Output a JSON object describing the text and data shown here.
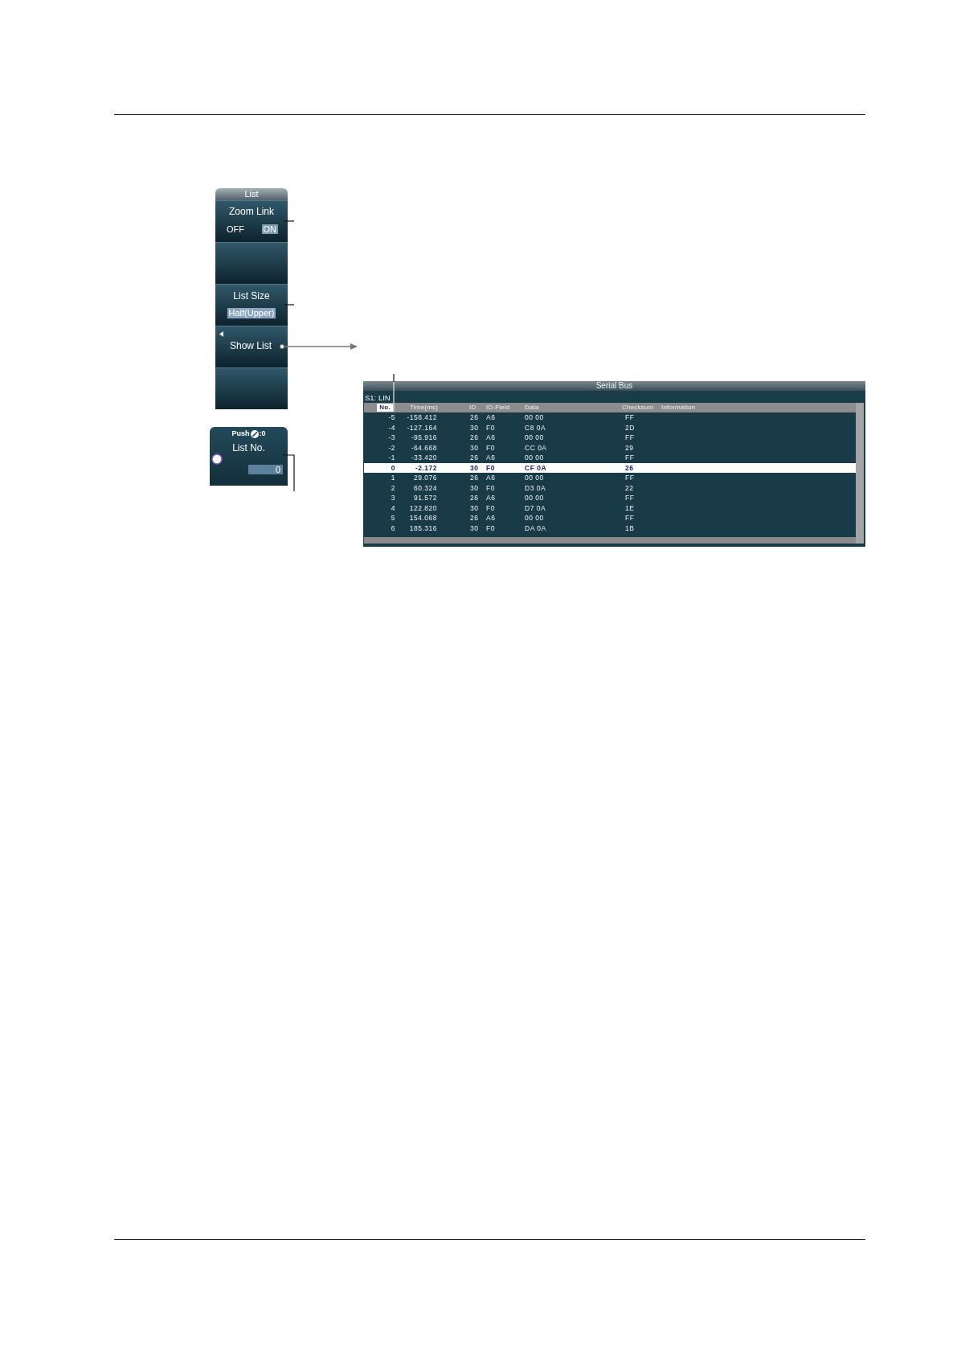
{
  "menu": {
    "title": "List",
    "items": [
      {
        "kind": "toggle",
        "label": "Zoom Link",
        "options": [
          {
            "label": "OFF",
            "selected": false
          },
          {
            "label": "ON",
            "selected": true
          }
        ]
      },
      {
        "kind": "empty"
      },
      {
        "kind": "value",
        "label": "List Size",
        "value": "Half(Upper)"
      },
      {
        "kind": "action",
        "label": "Show List"
      },
      {
        "kind": "empty"
      }
    ]
  },
  "knob_panel": {
    "hint": "Push",
    "hint_value": ":0",
    "label": "List No.",
    "value": "0"
  },
  "list_window": {
    "title": "Serial Bus",
    "source": "S1: LIN",
    "columns": [
      {
        "label": "No.",
        "selected": true
      },
      {
        "label": "Time(ms)",
        "selected": false
      },
      {
        "label": "ID",
        "selected": false
      },
      {
        "label": "ID-Field",
        "selected": false
      },
      {
        "label": "Data",
        "selected": false
      },
      {
        "label": "Checksum",
        "selected": false
      },
      {
        "label": "Information",
        "selected": false
      }
    ],
    "rows": [
      {
        "cells": [
          "-5",
          "-158.412",
          "26",
          "A6",
          "00 00",
          "FF"
        ],
        "selected": false
      },
      {
        "cells": [
          "-4",
          "-127.164",
          "30",
          "F0",
          "C8 0A",
          "2D"
        ],
        "selected": false
      },
      {
        "cells": [
          "-3",
          "-95.916",
          "26",
          "A6",
          "00 00",
          "FF"
        ],
        "selected": false
      },
      {
        "cells": [
          "-2",
          "-64.668",
          "30",
          "F0",
          "CC 0A",
          "29"
        ],
        "selected": false
      },
      {
        "cells": [
          "-1",
          "-33.420",
          "26",
          "A6",
          "00 00",
          "FF"
        ],
        "selected": false
      },
      {
        "cells": [
          "0",
          "-2.172",
          "30",
          "F0",
          "CF 0A",
          "26"
        ],
        "selected": true
      },
      {
        "cells": [
          "1",
          "29.076",
          "26",
          "A6",
          "00 00",
          "FF"
        ],
        "selected": false
      },
      {
        "cells": [
          "2",
          "60.324",
          "30",
          "F0",
          "D3 0A",
          "22"
        ],
        "selected": false
      },
      {
        "cells": [
          "3",
          "91.572",
          "26",
          "A6",
          "00 00",
          "FF"
        ],
        "selected": false
      },
      {
        "cells": [
          "4",
          "122.820",
          "30",
          "F0",
          "D7 0A",
          "1E"
        ],
        "selected": false
      },
      {
        "cells": [
          "5",
          "154.068",
          "26",
          "A6",
          "00 00",
          "FF"
        ],
        "selected": false
      },
      {
        "cells": [
          "6",
          "185.316",
          "30",
          "F0",
          "DA 0A",
          "1B"
        ],
        "selected": false
      }
    ]
  }
}
